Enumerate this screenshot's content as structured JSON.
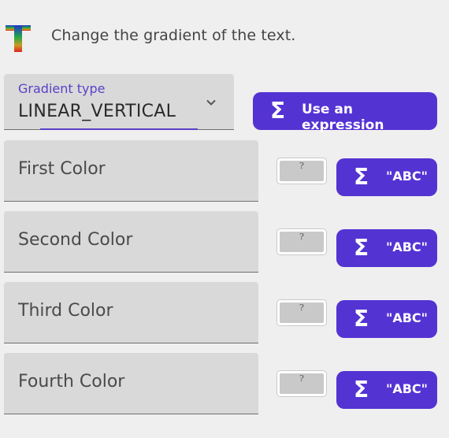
{
  "header": {
    "text": "Change the gradient of the text."
  },
  "gradient": {
    "caption": "Gradient type",
    "value": "LINEAR_VERTICAL"
  },
  "expression_button": {
    "label": "Use an expression"
  },
  "colors": [
    {
      "label": "First Color",
      "swatch_text": "?",
      "button_label": "\"ABC\""
    },
    {
      "label": "Second Color",
      "swatch_text": "?",
      "button_label": "\"ABC\""
    },
    {
      "label": "Third Color",
      "swatch_text": "?",
      "button_label": "\"ABC\""
    },
    {
      "label": "Fourth Color",
      "swatch_text": "?",
      "button_label": "\"ABC\""
    }
  ],
  "icons": {
    "sigma": "Σ",
    "chevron": "chevron-down-icon",
    "text_gradient": "gradient-text-icon"
  },
  "theme": {
    "accent": "#5433d3",
    "field_bg": "#d9d9d9",
    "page_bg": "#efefef"
  }
}
